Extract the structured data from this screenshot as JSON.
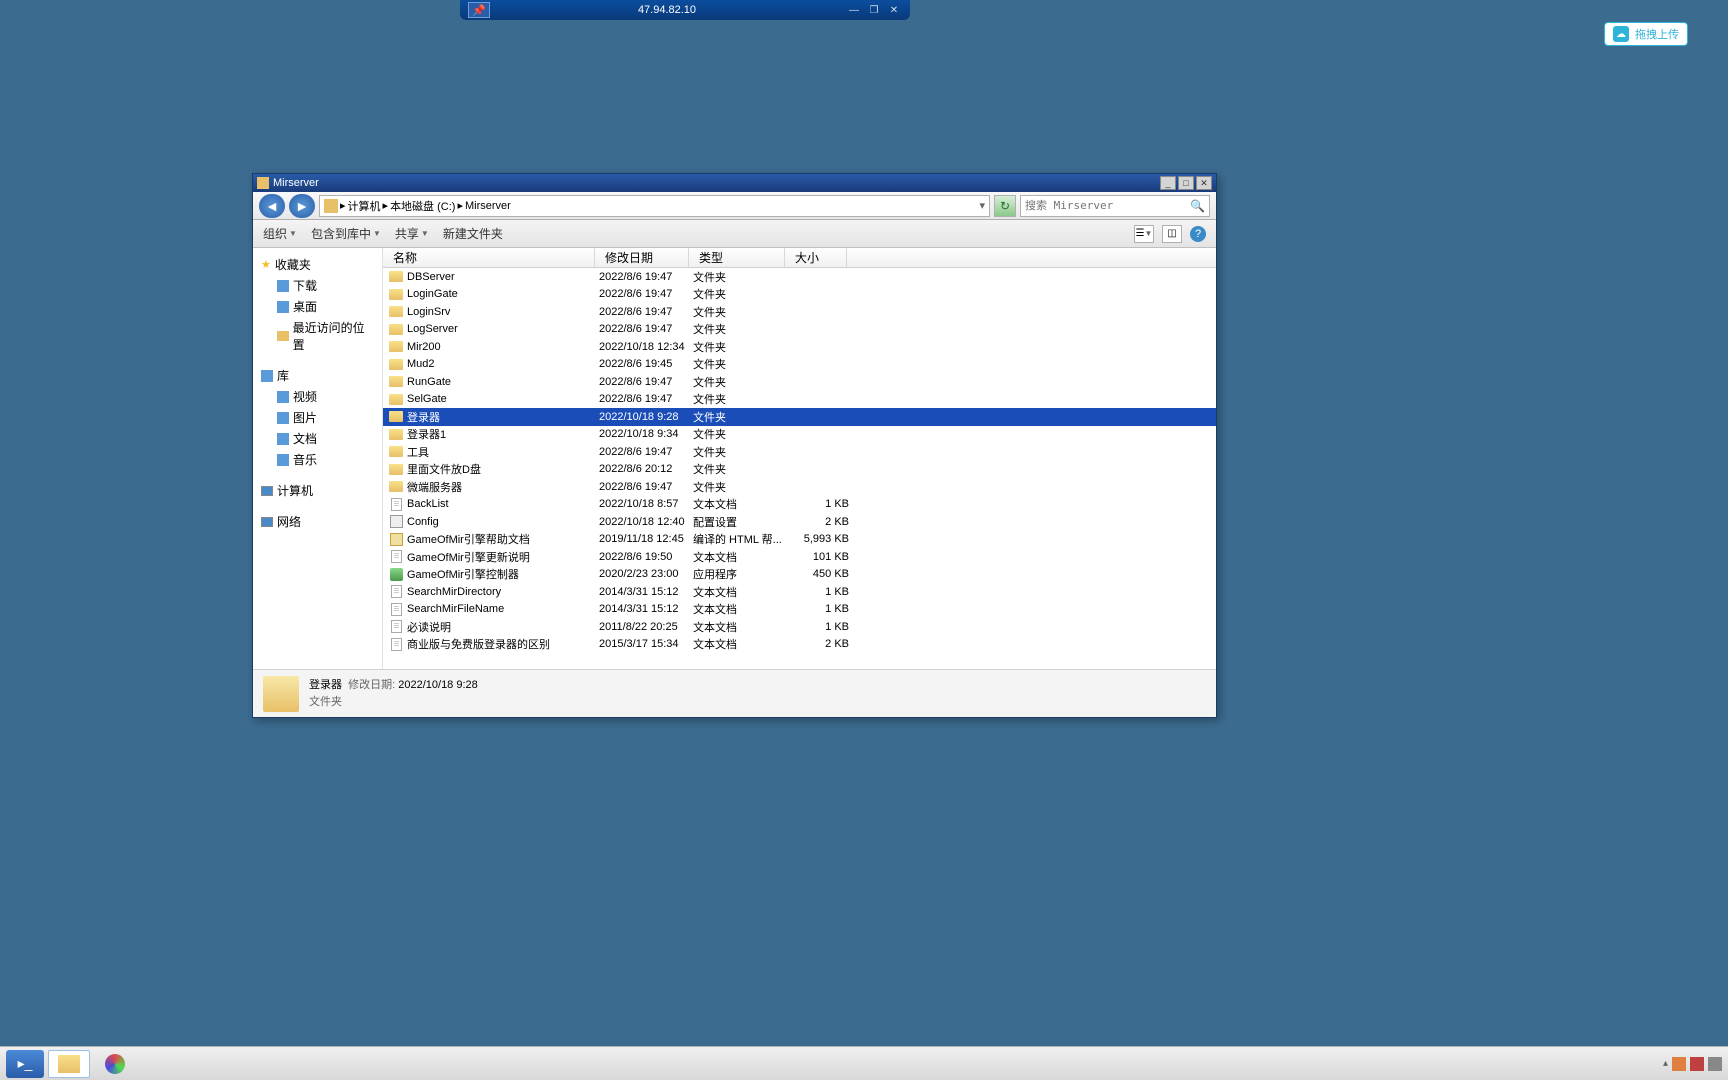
{
  "rdp": {
    "ip": "47.94.82.10"
  },
  "upload": {
    "label": "拖拽上传"
  },
  "explorer": {
    "title": "Mirserver",
    "breadcrumb": {
      "sep": "▸",
      "parts": [
        "计算机",
        "本地磁盘 (C:)",
        "Mirserver"
      ]
    },
    "search": {
      "placeholder": "搜索 Mirserver"
    },
    "toolbar": {
      "organize": "组织",
      "include": "包含到库中",
      "share": "共享",
      "newfolder": "新建文件夹"
    },
    "columns": {
      "name": "名称",
      "date": "修改日期",
      "type": "类型",
      "size": "大小"
    },
    "sidebar": {
      "favorites": {
        "label": "收藏夹",
        "items": [
          {
            "label": "下载",
            "icon": "download"
          },
          {
            "label": "桌面",
            "icon": "desktop"
          },
          {
            "label": "最近访问的位置",
            "icon": "recent"
          }
        ]
      },
      "libraries": {
        "label": "库",
        "items": [
          {
            "label": "视频"
          },
          {
            "label": "图片"
          },
          {
            "label": "文档"
          },
          {
            "label": "音乐"
          }
        ]
      },
      "computer": {
        "label": "计算机"
      },
      "network": {
        "label": "网络"
      }
    },
    "files": [
      {
        "name": "DBServer",
        "date": "2022/8/6 19:47",
        "type": "文件夹",
        "size": "",
        "kind": "folder"
      },
      {
        "name": "LoginGate",
        "date": "2022/8/6 19:47",
        "type": "文件夹",
        "size": "",
        "kind": "folder"
      },
      {
        "name": "LoginSrv",
        "date": "2022/8/6 19:47",
        "type": "文件夹",
        "size": "",
        "kind": "folder"
      },
      {
        "name": "LogServer",
        "date": "2022/8/6 19:47",
        "type": "文件夹",
        "size": "",
        "kind": "folder"
      },
      {
        "name": "Mir200",
        "date": "2022/10/18 12:34",
        "type": "文件夹",
        "size": "",
        "kind": "folder"
      },
      {
        "name": "Mud2",
        "date": "2022/8/6 19:45",
        "type": "文件夹",
        "size": "",
        "kind": "folder"
      },
      {
        "name": "RunGate",
        "date": "2022/8/6 19:47",
        "type": "文件夹",
        "size": "",
        "kind": "folder"
      },
      {
        "name": "SelGate",
        "date": "2022/8/6 19:47",
        "type": "文件夹",
        "size": "",
        "kind": "folder"
      },
      {
        "name": "登录器",
        "date": "2022/10/18 9:28",
        "type": "文件夹",
        "size": "",
        "kind": "folder",
        "selected": true
      },
      {
        "name": "登录器1",
        "date": "2022/10/18 9:34",
        "type": "文件夹",
        "size": "",
        "kind": "folder"
      },
      {
        "name": "工具",
        "date": "2022/8/6 19:47",
        "type": "文件夹",
        "size": "",
        "kind": "folder"
      },
      {
        "name": "里面文件放D盘",
        "date": "2022/8/6 20:12",
        "type": "文件夹",
        "size": "",
        "kind": "folder"
      },
      {
        "name": "微端服务器",
        "date": "2022/8/6 19:47",
        "type": "文件夹",
        "size": "",
        "kind": "folder"
      },
      {
        "name": "BackList",
        "date": "2022/10/18 8:57",
        "type": "文本文档",
        "size": "1 KB",
        "kind": "txt"
      },
      {
        "name": "Config",
        "date": "2022/10/18 12:40",
        "type": "配置设置",
        "size": "2 KB",
        "kind": "cfg"
      },
      {
        "name": "GameOfMir引擎帮助文档",
        "date": "2019/11/18 12:45",
        "type": "编译的 HTML 帮...",
        "size": "5,993 KB",
        "kind": "chm"
      },
      {
        "name": "GameOfMir引擎更新说明",
        "date": "2022/8/6 19:50",
        "type": "文本文档",
        "size": "101 KB",
        "kind": "txt"
      },
      {
        "name": "GameOfMir引擎控制器",
        "date": "2020/2/23 23:00",
        "type": "应用程序",
        "size": "450 KB",
        "kind": "exe"
      },
      {
        "name": "SearchMirDirectory",
        "date": "2014/3/31 15:12",
        "type": "文本文档",
        "size": "1 KB",
        "kind": "txt"
      },
      {
        "name": "SearchMirFileName",
        "date": "2014/3/31 15:12",
        "type": "文本文档",
        "size": "1 KB",
        "kind": "txt"
      },
      {
        "name": "必读说明",
        "date": "2011/8/22 20:25",
        "type": "文本文档",
        "size": "1 KB",
        "kind": "txt"
      },
      {
        "name": "商业版与免费版登录器的区别",
        "date": "2015/3/17 15:34",
        "type": "文本文档",
        "size": "2 KB",
        "kind": "txt"
      }
    ],
    "status": {
      "name": "登录器",
      "date_label": "修改日期:",
      "date": "2022/10/18 9:28",
      "type": "文件夹"
    }
  }
}
